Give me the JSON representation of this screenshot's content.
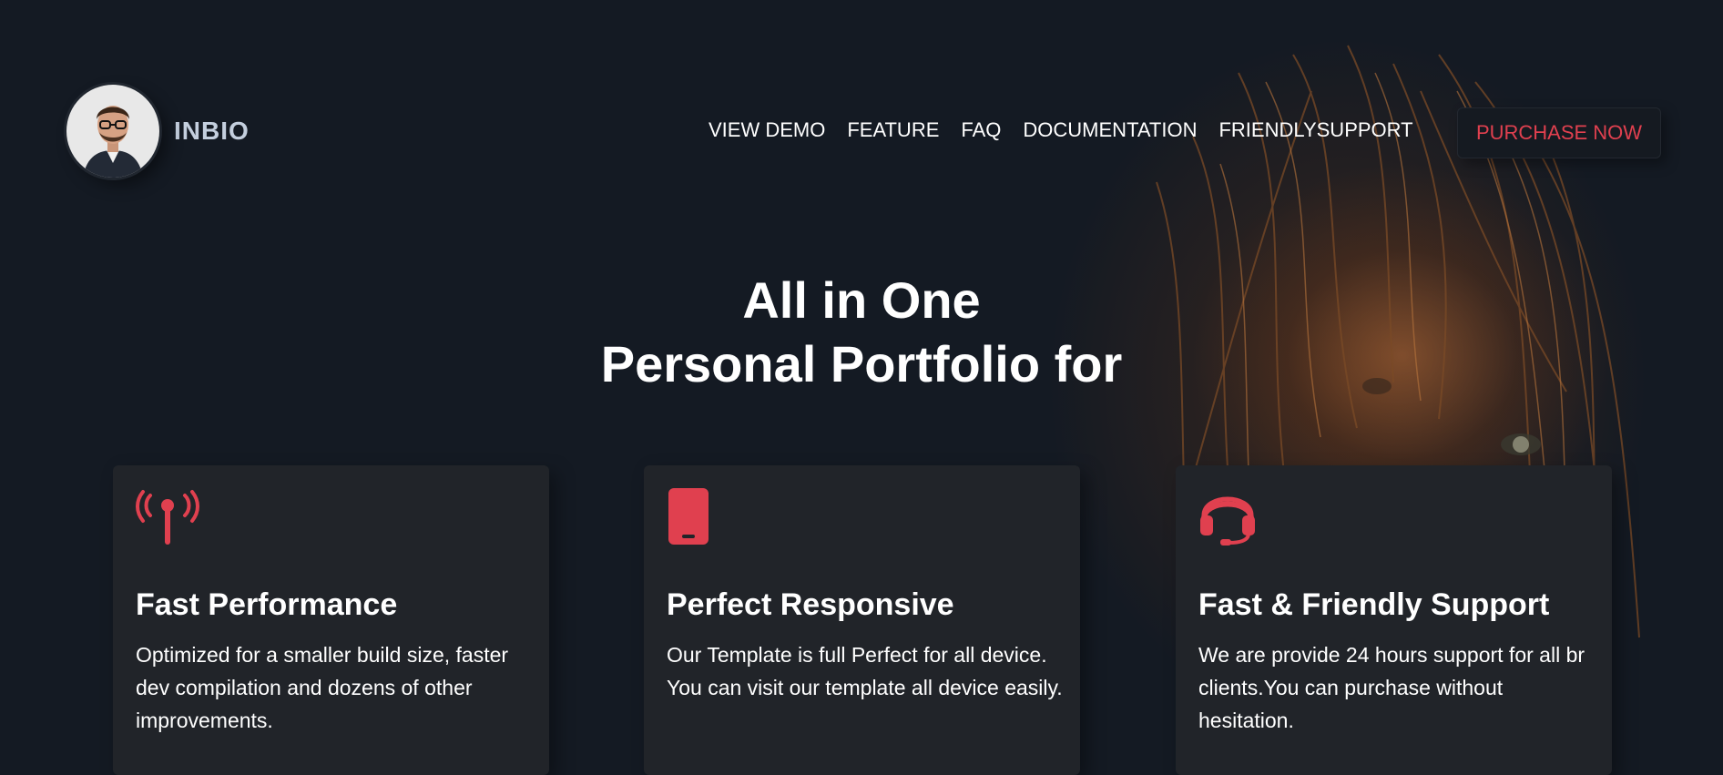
{
  "header": {
    "brand": "INBIO",
    "nav": [
      {
        "label": "VIEW DEMO"
      },
      {
        "label": "FEATURE"
      },
      {
        "label": "FAQ"
      },
      {
        "label": "DOCUMENTATION"
      },
      {
        "label": "FRIENDLYSUPPORT"
      }
    ],
    "purchase_label": "PURCHASE NOW"
  },
  "hero": {
    "line1": "All in One",
    "line2": "Personal Portfolio for"
  },
  "cards": [
    {
      "icon": "antenna-icon",
      "title": "Fast Performance",
      "description": "Optimized for a smaller build size, faster dev compilation and dozens of other improvements."
    },
    {
      "icon": "mobile-device-icon",
      "title": "Perfect Responsive",
      "description": "Our Template is full Perfect for all device. You can visit our template all device easily."
    },
    {
      "icon": "headset-icon",
      "title": "Fast & Friendly Support",
      "description": "We are provide 24 hours support for all br clients.You can purchase without hesitation."
    }
  ],
  "colors": {
    "background": "#141a23",
    "card": "#212429",
    "accent": "#e0404f",
    "brand_text": "#c4cfde"
  }
}
